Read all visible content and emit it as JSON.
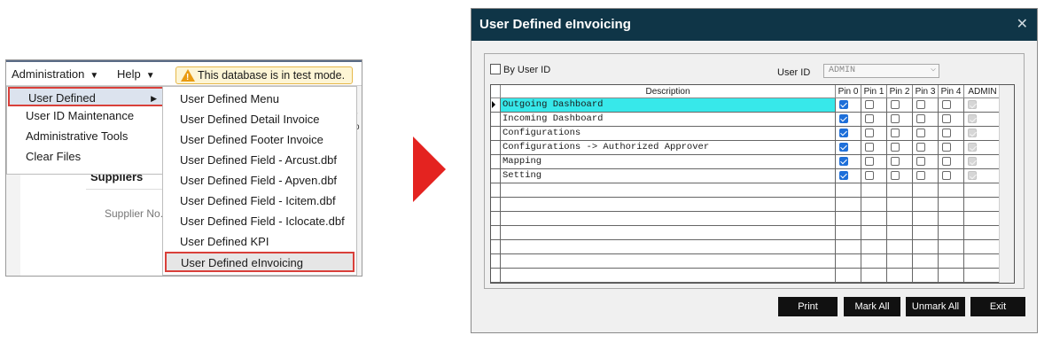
{
  "menubar": {
    "administration": "Administration",
    "help": "Help",
    "warning": "This database is in test mode."
  },
  "admin_menu": {
    "items": [
      "User Defined",
      "User ID Maintenance",
      "Administrative Tools",
      "Clear Files"
    ]
  },
  "background": {
    "suppliers": "Suppliers",
    "supplier_no": "Supplier No.",
    "clipped_a": "r",
    "clipped_b": "o"
  },
  "submenu": {
    "items": [
      "User Defined Menu",
      "User Defined Detail Invoice",
      "User Defined Footer Invoice",
      "User Defined Field - Arcust.dbf",
      "User Defined Field - Apven.dbf",
      "User Defined Field - Icitem.dbf",
      "User Defined Field - Iclocate.dbf",
      "User Defined KPI",
      "User Defined eInvoicing"
    ]
  },
  "dialog": {
    "title": "User Defined eInvoicing",
    "by_user_id": "By User ID",
    "user_id_label": "User ID",
    "user_id_value": "ADMIN",
    "columns": [
      "Description",
      "Pin 0",
      "Pin 1",
      "Pin 2",
      "Pin 3",
      "Pin 4",
      "ADMIN"
    ],
    "rows": [
      {
        "desc": "Outgoing Dashboard",
        "pin0": true,
        "pin1": false,
        "pin2": false,
        "pin3": false,
        "pin4": false,
        "admin": true,
        "selected": true
      },
      {
        "desc": "Incoming Dashboard",
        "pin0": true,
        "pin1": false,
        "pin2": false,
        "pin3": false,
        "pin4": false,
        "admin": true
      },
      {
        "desc": "Configurations",
        "pin0": true,
        "pin1": false,
        "pin2": false,
        "pin3": false,
        "pin4": false,
        "admin": true
      },
      {
        "desc": "Configurations -> Authorized Approver",
        "pin0": true,
        "pin1": false,
        "pin2": false,
        "pin3": false,
        "pin4": false,
        "admin": true
      },
      {
        "desc": "Mapping",
        "pin0": true,
        "pin1": false,
        "pin2": false,
        "pin3": false,
        "pin4": false,
        "admin": true
      },
      {
        "desc": "Setting",
        "pin0": true,
        "pin1": false,
        "pin2": false,
        "pin3": false,
        "pin4": false,
        "admin": true
      }
    ],
    "buttons": {
      "print": "Print",
      "mark_all": "Mark All",
      "unmark_all": "Unmark All",
      "exit": "Exit"
    }
  },
  "colors": {
    "title_bar": "#0f3547",
    "highlight_border": "#d9403a",
    "selected_row": "#37e8ea",
    "arrow": "#e42320",
    "checkbox_on": "#1e6fd9"
  }
}
